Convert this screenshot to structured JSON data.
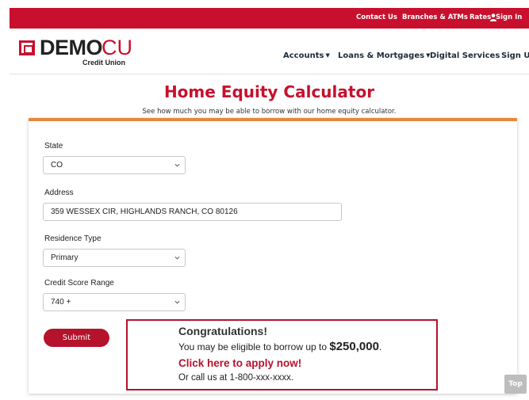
{
  "utility_nav": {
    "contact": "Contact Us",
    "branches": "Branches & ATMs",
    "rates": "Rates",
    "signin": "Sign In"
  },
  "brand": {
    "name_primary": "DEMO",
    "name_accent": "CU",
    "tagline": "Credit Union",
    "accent_color": "#c8102e"
  },
  "main_nav": {
    "accounts": "Accounts",
    "loans": "Loans & Mortgages",
    "digital": "Digital Services",
    "signup": "Sign Up"
  },
  "page": {
    "title": "Home Equity Calculator",
    "subtitle": "See how much you may be able to borrow with our home equity calculator."
  },
  "form": {
    "state": {
      "label": "State",
      "value": "CO"
    },
    "address": {
      "label": "Address",
      "value": "359 WESSEX CIR, HIGHLANDS RANCH, CO 80126"
    },
    "residence": {
      "label": "Residence Type",
      "value": "Primary"
    },
    "credit": {
      "label": "Credit Score Range",
      "value": "740 +"
    },
    "submit_label": "Submit"
  },
  "result": {
    "heading": "Congratulations!",
    "eligible_text": "You may be eligible to borrow up to",
    "amount": "$250,000",
    "apply_link": "Click here to apply now!",
    "call_text": "Or call us at 1-800-xxx-xxxx."
  },
  "scroll_top_label": "Top"
}
